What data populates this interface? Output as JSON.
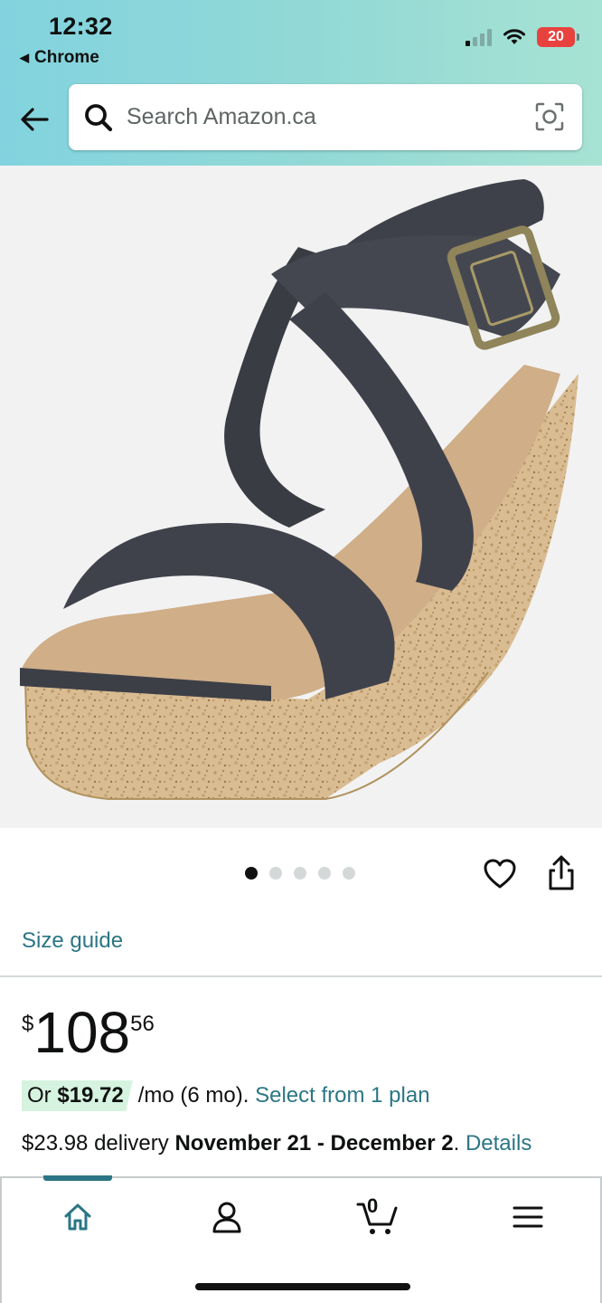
{
  "status_bar": {
    "time": "12:32",
    "back_app_label": "Chrome",
    "battery_level": "20"
  },
  "search": {
    "placeholder": "Search Amazon.ca"
  },
  "carousel": {
    "total_images": 5,
    "active_index": 0
  },
  "product": {
    "size_guide_label": "Size guide",
    "price_symbol": "$",
    "price_whole": "108",
    "price_fraction": "56",
    "installment_prefix": "Or",
    "installment_amount": "$19.72",
    "installment_term": "/mo (6 mo).",
    "installment_link": "Select from 1 plan",
    "delivery_prefix": "$23.98 delivery",
    "delivery_dates": "November 21 - December 2",
    "delivery_period": ".",
    "delivery_details_link": "Details"
  },
  "bottom_nav": {
    "items": [
      "home-icon",
      "account-icon",
      "cart-icon",
      "menu-icon"
    ],
    "active": "home",
    "cart_count": "0"
  },
  "colors": {
    "header_gradient_start": "#82d3df",
    "header_gradient_end": "#a7e3d4",
    "link": "#2b7685",
    "installment_badge": "#d6f3df",
    "battery_low": "#e8423f",
    "cork": "#d7b98f",
    "strap": "#3d3f47"
  }
}
